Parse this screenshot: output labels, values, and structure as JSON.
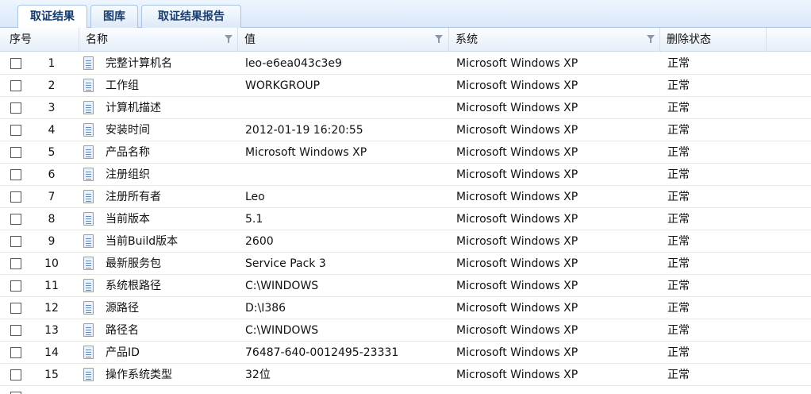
{
  "tabs": [
    {
      "label": "取证结果",
      "active": true
    },
    {
      "label": "图库",
      "active": false
    },
    {
      "label": "取证结果报告",
      "active": false
    }
  ],
  "columns": [
    "序号",
    "名称",
    "值",
    "系统",
    "删除状态"
  ],
  "rows": [
    {
      "index": "1",
      "name": "完整计算机名",
      "value": "leo-e6ea043c3e9",
      "system": "Microsoft Windows XP",
      "status": "正常"
    },
    {
      "index": "2",
      "name": "工作组",
      "value": "WORKGROUP",
      "system": "Microsoft Windows XP",
      "status": "正常"
    },
    {
      "index": "3",
      "name": "计算机描述",
      "value": "",
      "system": "Microsoft Windows XP",
      "status": "正常"
    },
    {
      "index": "4",
      "name": "安装时间",
      "value": "2012-01-19 16:20:55",
      "system": "Microsoft Windows XP",
      "status": "正常"
    },
    {
      "index": "5",
      "name": "产品名称",
      "value": "Microsoft Windows XP",
      "system": "Microsoft Windows XP",
      "status": "正常"
    },
    {
      "index": "6",
      "name": "注册组织",
      "value": "",
      "system": "Microsoft Windows XP",
      "status": "正常"
    },
    {
      "index": "7",
      "name": "注册所有者",
      "value": "Leo",
      "system": "Microsoft Windows XP",
      "status": "正常"
    },
    {
      "index": "8",
      "name": "当前版本",
      "value": "5.1",
      "system": "Microsoft Windows XP",
      "status": "正常"
    },
    {
      "index": "9",
      "name": "当前Build版本",
      "value": "2600",
      "system": "Microsoft Windows XP",
      "status": "正常"
    },
    {
      "index": "10",
      "name": "最新服务包",
      "value": "Service Pack 3",
      "system": "Microsoft Windows XP",
      "status": "正常"
    },
    {
      "index": "11",
      "name": "系统根路径",
      "value": "C:\\WINDOWS",
      "system": "Microsoft Windows XP",
      "status": "正常"
    },
    {
      "index": "12",
      "name": "源路径",
      "value": "D:\\I386",
      "system": "Microsoft Windows XP",
      "status": "正常"
    },
    {
      "index": "13",
      "name": "路径名",
      "value": "C:\\WINDOWS",
      "system": "Microsoft Windows XP",
      "status": "正常"
    },
    {
      "index": "14",
      "name": "产品ID",
      "value": "76487-640-0012495-23331",
      "system": "Microsoft Windows XP",
      "status": "正常"
    },
    {
      "index": "15",
      "name": "操作系统类型",
      "value": "32位",
      "system": "Microsoft Windows XP",
      "status": "正常"
    }
  ]
}
